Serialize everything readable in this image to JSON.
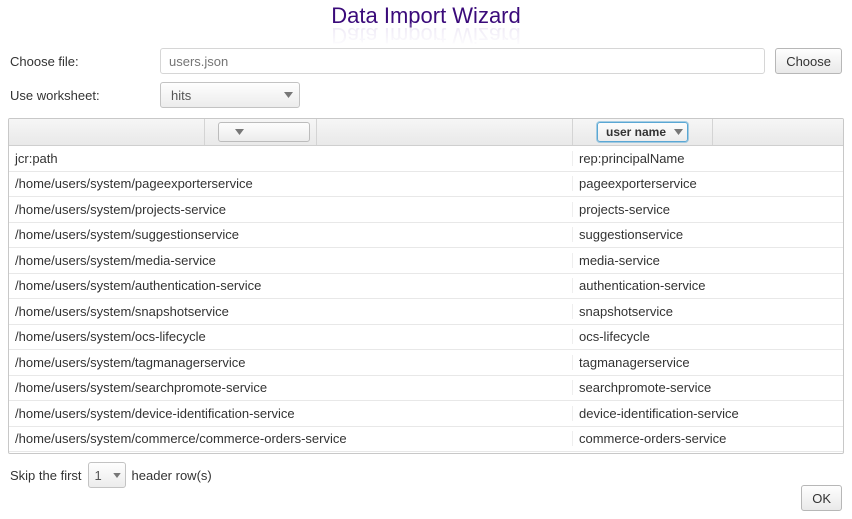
{
  "title": "Data Import Wizard",
  "form": {
    "choose_file_label": "Choose file:",
    "file_placeholder": "users.json",
    "choose_button": "Choose",
    "worksheet_label": "Use worksheet:",
    "worksheet_value": "hits"
  },
  "table": {
    "header_dropdowns": {
      "col1_value": "",
      "col3_value": "user name"
    },
    "rows": [
      {
        "path": "jcr:path",
        "name": "rep:principalName"
      },
      {
        "path": "/home/users/system/pageexporterservice",
        "name": "pageexporterservice"
      },
      {
        "path": "/home/users/system/projects-service",
        "name": "projects-service"
      },
      {
        "path": "/home/users/system/suggestionservice",
        "name": "suggestionservice"
      },
      {
        "path": "/home/users/system/media-service",
        "name": "media-service"
      },
      {
        "path": "/home/users/system/authentication-service",
        "name": "authentication-service"
      },
      {
        "path": "/home/users/system/snapshotservice",
        "name": "snapshotservice"
      },
      {
        "path": "/home/users/system/ocs-lifecycle",
        "name": "ocs-lifecycle"
      },
      {
        "path": "/home/users/system/tagmanagerservice",
        "name": "tagmanagerservice"
      },
      {
        "path": "/home/users/system/searchpromote-service",
        "name": "searchpromote-service"
      },
      {
        "path": "/home/users/system/device-identification-service",
        "name": "device-identification-service"
      },
      {
        "path": "/home/users/system/commerce/commerce-orders-service",
        "name": "commerce-orders-service"
      }
    ]
  },
  "footer": {
    "skip_prefix": "Skip the first",
    "skip_value": "1",
    "skip_suffix": "header row(s)",
    "ok_button": "OK"
  }
}
